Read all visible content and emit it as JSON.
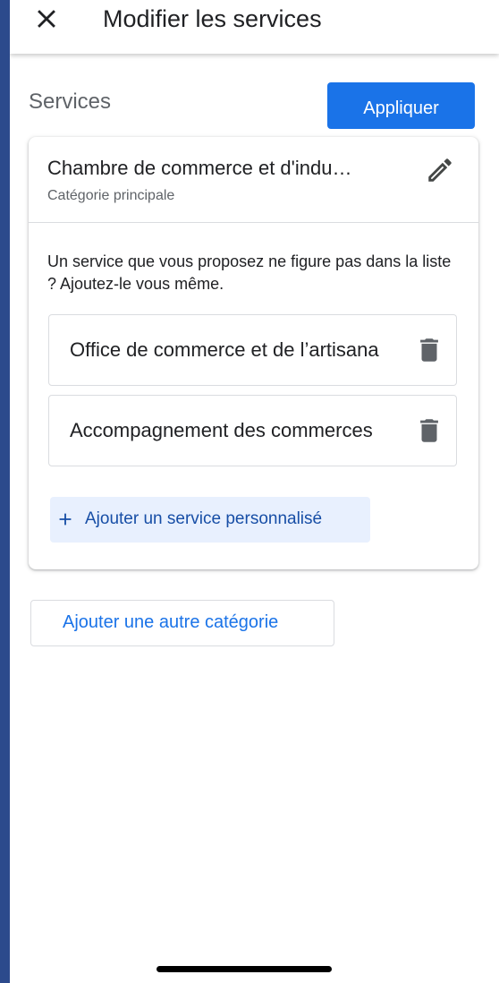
{
  "header": {
    "title": "Modifier les services",
    "close_icon": "close-icon"
  },
  "services_section": {
    "label": "Services",
    "apply_label": "Appliquer"
  },
  "category_card": {
    "title": "Chambre de commerce et d'indu…",
    "subtitle": "Catégorie principale",
    "edit_icon": "pencil-icon",
    "help_text": "Un service que vous proposez ne figure pas dans la liste ? Ajoutez-le vous même.",
    "services": [
      {
        "name": "Office de commerce et de l’artisana",
        "delete_icon": "trash-icon"
      },
      {
        "name": "Accompagnement des commerces",
        "delete_icon": "trash-icon"
      }
    ],
    "add_service_label": "Ajouter un service personnalisé"
  },
  "add_category_label": "Ajouter une autre catégorie",
  "colors": {
    "accent": "#1a73e8",
    "accent_dark": "#174ea6",
    "chip_background": "#e8f0fe",
    "side_strip": "#2c4a8c"
  }
}
